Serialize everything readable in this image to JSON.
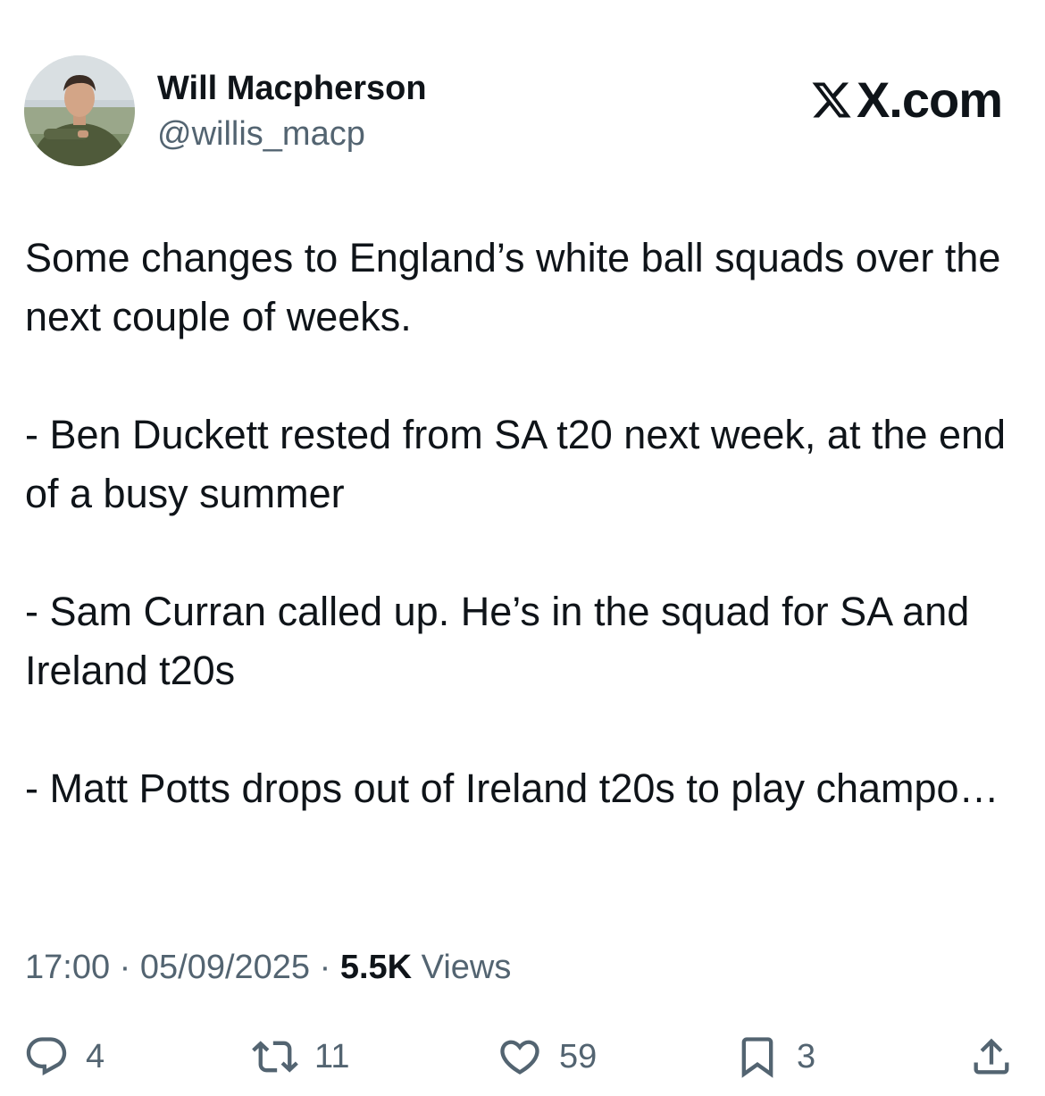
{
  "author": {
    "display_name": "Will Macpherson",
    "handle": "@willis_macp"
  },
  "brand": {
    "text": "X.com"
  },
  "tweet": {
    "paragraphs": [
      "Some changes to England’s white ball squads over the next couple of weeks.",
      "- Ben Duckett rested from SA t20 next week, at the end of a busy summer",
      "- Sam Curran called up. He’s in the squad for SA and Ireland t20s",
      "- Matt Potts drops out of Ireland t20s to play champo…"
    ]
  },
  "meta": {
    "time": "17:00",
    "separator": " · ",
    "date": "05/09/2025",
    "views_count": "5.5K",
    "views_label": " Views"
  },
  "actions": {
    "reply_count": "4",
    "repost_count": "11",
    "like_count": "59",
    "bookmark_count": "3"
  },
  "icons": {
    "avatar": "avatar-photo",
    "reply": "reply-icon",
    "repost": "repost-icon",
    "like": "heart-icon",
    "bookmark": "bookmark-icon",
    "share": "share-icon",
    "brand": "x-logo-icon"
  },
  "colors": {
    "text_primary": "#0f1419",
    "text_secondary": "#536471",
    "background": "#ffffff"
  }
}
